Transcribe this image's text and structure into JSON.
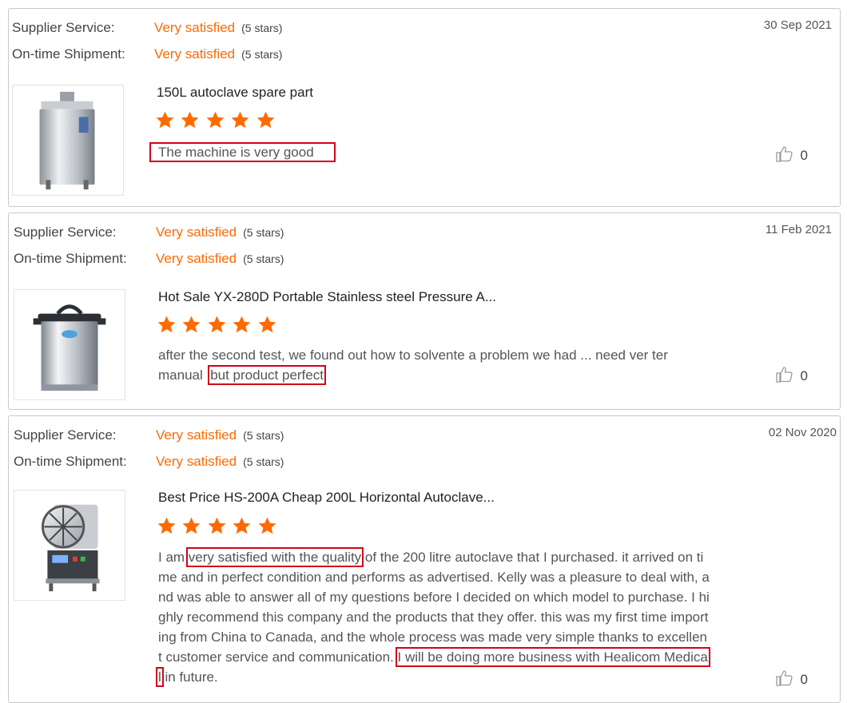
{
  "labels": {
    "supplier_service": "Supplier Service:",
    "ontime_shipment": "On-time Shipment:"
  },
  "colors": {
    "accent": "#ff6a00",
    "highlight_box": "#d0021b",
    "card_border": "#c8c8c8"
  },
  "reviews": [
    {
      "date": "30 Sep 2021",
      "supplier_service": {
        "text": "Very satisfied",
        "note": "(5 stars)"
      },
      "ontime_shipment": {
        "text": "Very satisfied",
        "note": "(5 stars)"
      },
      "product_title": "150L autoclave spare part",
      "rating": 5,
      "body": {
        "pre": "",
        "highlight": "The machine is very good",
        "post": ""
      },
      "likes": "0",
      "thumbnail_icon": "vertical-autoclave-image"
    },
    {
      "date": "11 Feb 2021",
      "supplier_service": {
        "text": "Very satisfied",
        "note": "(5 stars)"
      },
      "ontime_shipment": {
        "text": "Very satisfied",
        "note": "(5 stars)"
      },
      "product_title": "Hot Sale YX-280D Portable Stainless steel Pressure A...",
      "rating": 5,
      "body": {
        "pre": "after the second test, we found out how to solvente a problem we had ... need ver ter manual ,",
        "highlight": "but product perfect",
        "post": ""
      },
      "likes": "0",
      "thumbnail_icon": "portable-autoclave-image"
    },
    {
      "date": "02 Nov 2020",
      "supplier_service": {
        "text": "Very satisfied",
        "note": "(5 stars)"
      },
      "ontime_shipment": {
        "text": "Very satisfied",
        "note": "(5 stars)"
      },
      "product_title": "Best Price HS-200A Cheap 200L Horizontal Autoclave...",
      "rating": 5,
      "body": {
        "pre": "I am ",
        "highlight": "very satisfied with the quality",
        "mid": " of the 200 litre  autoclave that I purchased. it arrived on time and in perfect condition and performs as advertised. Kelly was a pleasure to deal with, and was able to answer all of my questions before I decided on which model to purchase. I highly recommend this company and the products that they offer. this was my first time importing from China to Canada, and the whole process was made very simple thanks to excellent customer service and communication. ",
        "highlight2": "I will be doing more business with Healicom Medical",
        "post": " in future."
      },
      "likes": "0",
      "thumbnail_icon": "horizontal-autoclave-image"
    }
  ]
}
